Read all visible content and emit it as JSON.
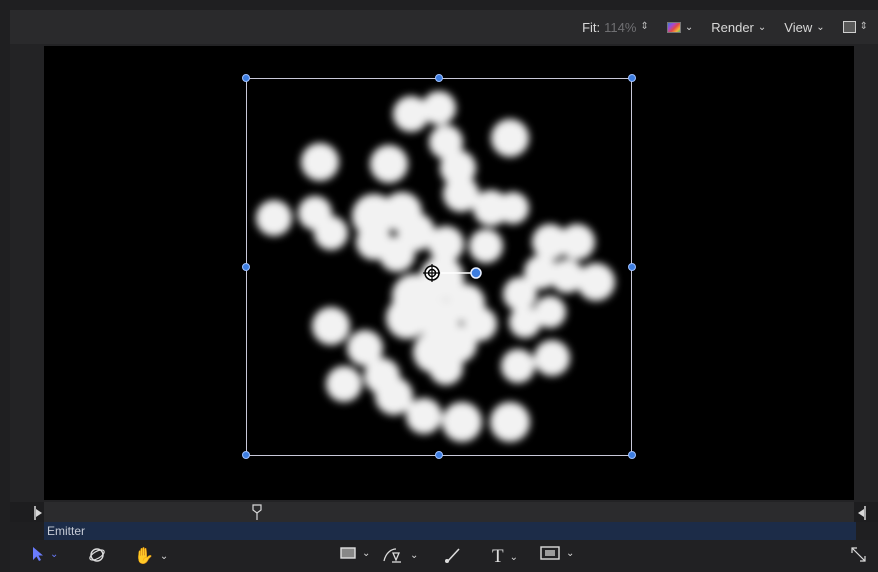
{
  "topbar": {
    "fit_label": "Fit:",
    "fit_value": "114%",
    "render_label": "Render",
    "view_label": "View"
  },
  "canvas": {
    "background_color": "#000000",
    "handle_color": "#3d7de0"
  },
  "timeline": {
    "object_label": "Emitter"
  },
  "toolbar": {
    "text_tool_label": "T"
  },
  "icons": {
    "select": "arrow-select-icon",
    "orbit": "3d-orbit-icon",
    "pan": "hand-pan-icon",
    "shape": "rectangle-shape-icon",
    "pen": "bezier-pen-icon",
    "paint": "paint-stroke-icon",
    "mask": "mask-icon",
    "expand": "expand-icon"
  }
}
